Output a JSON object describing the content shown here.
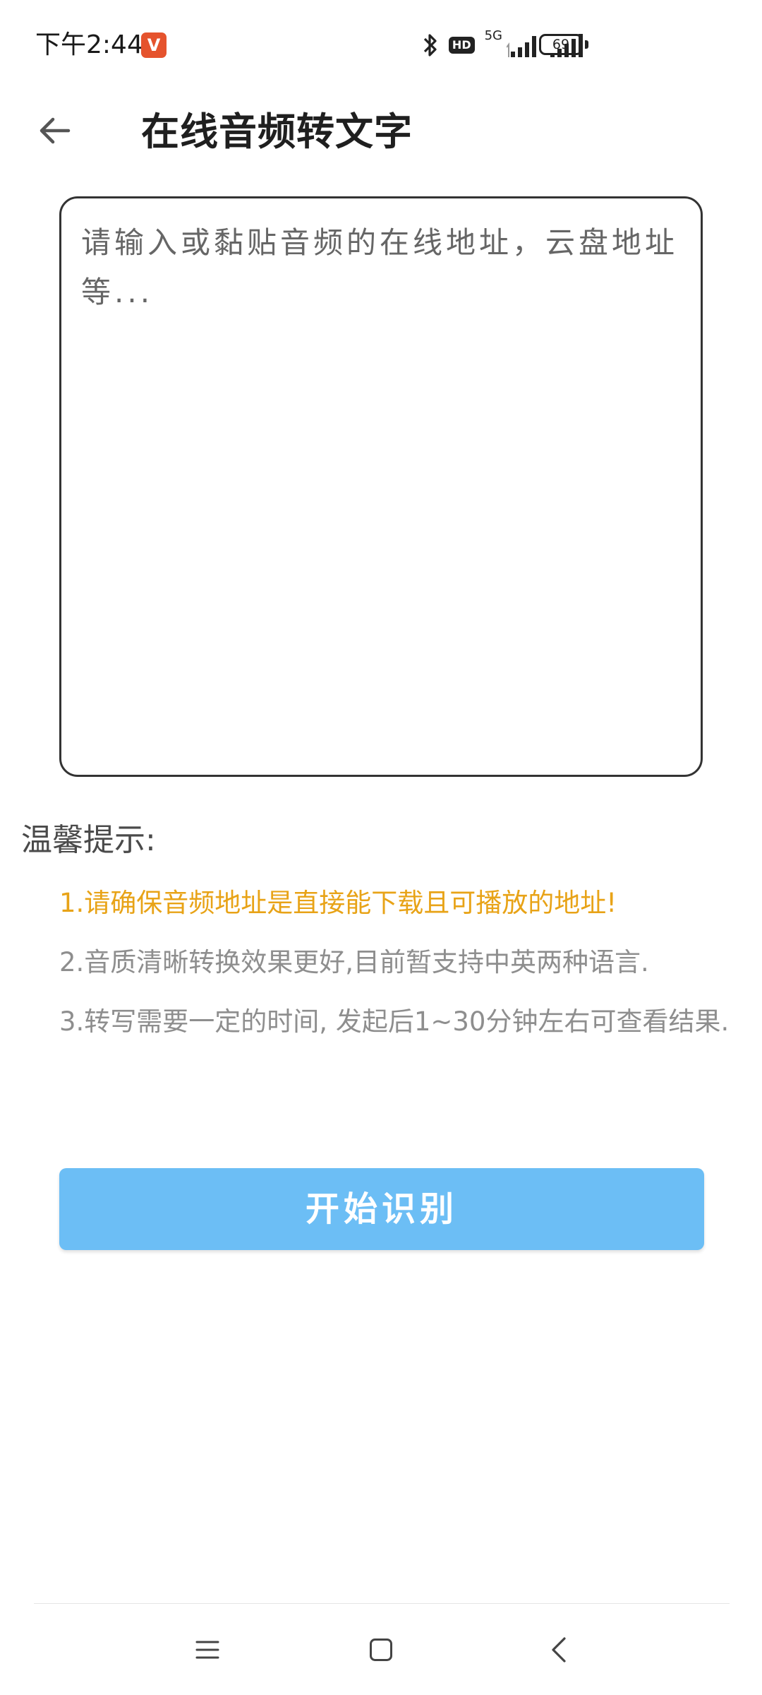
{
  "status_bar": {
    "time": "下午2:44",
    "app_badge": "V",
    "hd": "HD",
    "network": "5G",
    "battery": "69"
  },
  "header": {
    "title": "在线音频转文字"
  },
  "input": {
    "placeholder": "请输入或黏贴音频的在线地址，云盘地址等...",
    "value": ""
  },
  "tips": {
    "title": "温馨提示:",
    "items": [
      "1.请确保音频地址是直接能下载且可播放的地址!",
      "2.音质清晰转换效果更好,目前暂支持中英两种语言.",
      "3.转写需要一定的时间, 发起后1~30分钟左右可查看结果."
    ],
    "highlight_color": "#e8a317",
    "normal_color": "#8e8e8e"
  },
  "actions": {
    "start_label": "开始识别",
    "start_color": "#6cbef5"
  },
  "nav": {
    "icons": [
      "menu-icon",
      "home-icon",
      "back-icon"
    ]
  }
}
